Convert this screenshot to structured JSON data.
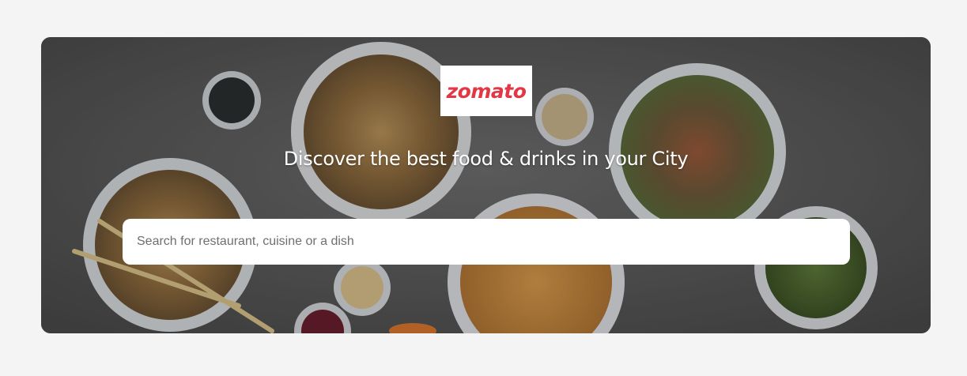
{
  "brand": {
    "logo_text": "zomato",
    "brand_color": "#e23744"
  },
  "hero": {
    "tagline": "Discover the best food & drinks in your City",
    "background": "food-bowls-photo"
  },
  "search": {
    "placeholder": "Search for restaurant, cuisine or a dish",
    "value": ""
  }
}
